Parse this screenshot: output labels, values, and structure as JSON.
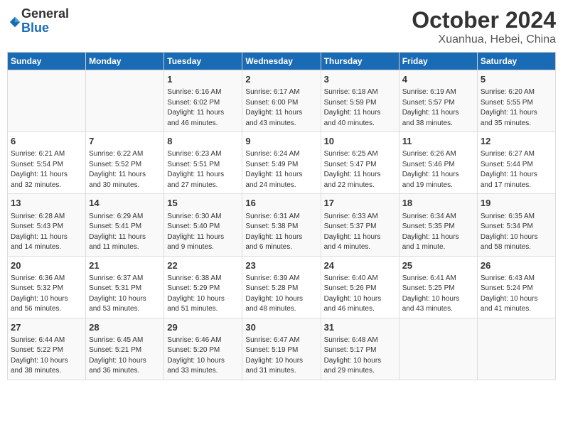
{
  "header": {
    "logo_general": "General",
    "logo_blue": "Blue",
    "title": "October 2024",
    "subtitle": "Xuanhua, Hebei, China"
  },
  "columns": [
    "Sunday",
    "Monday",
    "Tuesday",
    "Wednesday",
    "Thursday",
    "Friday",
    "Saturday"
  ],
  "rows": [
    [
      {
        "day": "",
        "lines": []
      },
      {
        "day": "",
        "lines": []
      },
      {
        "day": "1",
        "lines": [
          "Sunrise: 6:16 AM",
          "Sunset: 6:02 PM",
          "Daylight: 11 hours",
          "and 46 minutes."
        ]
      },
      {
        "day": "2",
        "lines": [
          "Sunrise: 6:17 AM",
          "Sunset: 6:00 PM",
          "Daylight: 11 hours",
          "and 43 minutes."
        ]
      },
      {
        "day": "3",
        "lines": [
          "Sunrise: 6:18 AM",
          "Sunset: 5:59 PM",
          "Daylight: 11 hours",
          "and 40 minutes."
        ]
      },
      {
        "day": "4",
        "lines": [
          "Sunrise: 6:19 AM",
          "Sunset: 5:57 PM",
          "Daylight: 11 hours",
          "and 38 minutes."
        ]
      },
      {
        "day": "5",
        "lines": [
          "Sunrise: 6:20 AM",
          "Sunset: 5:55 PM",
          "Daylight: 11 hours",
          "and 35 minutes."
        ]
      }
    ],
    [
      {
        "day": "6",
        "lines": [
          "Sunrise: 6:21 AM",
          "Sunset: 5:54 PM",
          "Daylight: 11 hours",
          "and 32 minutes."
        ]
      },
      {
        "day": "7",
        "lines": [
          "Sunrise: 6:22 AM",
          "Sunset: 5:52 PM",
          "Daylight: 11 hours",
          "and 30 minutes."
        ]
      },
      {
        "day": "8",
        "lines": [
          "Sunrise: 6:23 AM",
          "Sunset: 5:51 PM",
          "Daylight: 11 hours",
          "and 27 minutes."
        ]
      },
      {
        "day": "9",
        "lines": [
          "Sunrise: 6:24 AM",
          "Sunset: 5:49 PM",
          "Daylight: 11 hours",
          "and 24 minutes."
        ]
      },
      {
        "day": "10",
        "lines": [
          "Sunrise: 6:25 AM",
          "Sunset: 5:47 PM",
          "Daylight: 11 hours",
          "and 22 minutes."
        ]
      },
      {
        "day": "11",
        "lines": [
          "Sunrise: 6:26 AM",
          "Sunset: 5:46 PM",
          "Daylight: 11 hours",
          "and 19 minutes."
        ]
      },
      {
        "day": "12",
        "lines": [
          "Sunrise: 6:27 AM",
          "Sunset: 5:44 PM",
          "Daylight: 11 hours",
          "and 17 minutes."
        ]
      }
    ],
    [
      {
        "day": "13",
        "lines": [
          "Sunrise: 6:28 AM",
          "Sunset: 5:43 PM",
          "Daylight: 11 hours",
          "and 14 minutes."
        ]
      },
      {
        "day": "14",
        "lines": [
          "Sunrise: 6:29 AM",
          "Sunset: 5:41 PM",
          "Daylight: 11 hours",
          "and 11 minutes."
        ]
      },
      {
        "day": "15",
        "lines": [
          "Sunrise: 6:30 AM",
          "Sunset: 5:40 PM",
          "Daylight: 11 hours",
          "and 9 minutes."
        ]
      },
      {
        "day": "16",
        "lines": [
          "Sunrise: 6:31 AM",
          "Sunset: 5:38 PM",
          "Daylight: 11 hours",
          "and 6 minutes."
        ]
      },
      {
        "day": "17",
        "lines": [
          "Sunrise: 6:33 AM",
          "Sunset: 5:37 PM",
          "Daylight: 11 hours",
          "and 4 minutes."
        ]
      },
      {
        "day": "18",
        "lines": [
          "Sunrise: 6:34 AM",
          "Sunset: 5:35 PM",
          "Daylight: 11 hours",
          "and 1 minute."
        ]
      },
      {
        "day": "19",
        "lines": [
          "Sunrise: 6:35 AM",
          "Sunset: 5:34 PM",
          "Daylight: 10 hours",
          "and 58 minutes."
        ]
      }
    ],
    [
      {
        "day": "20",
        "lines": [
          "Sunrise: 6:36 AM",
          "Sunset: 5:32 PM",
          "Daylight: 10 hours",
          "and 56 minutes."
        ]
      },
      {
        "day": "21",
        "lines": [
          "Sunrise: 6:37 AM",
          "Sunset: 5:31 PM",
          "Daylight: 10 hours",
          "and 53 minutes."
        ]
      },
      {
        "day": "22",
        "lines": [
          "Sunrise: 6:38 AM",
          "Sunset: 5:29 PM",
          "Daylight: 10 hours",
          "and 51 minutes."
        ]
      },
      {
        "day": "23",
        "lines": [
          "Sunrise: 6:39 AM",
          "Sunset: 5:28 PM",
          "Daylight: 10 hours",
          "and 48 minutes."
        ]
      },
      {
        "day": "24",
        "lines": [
          "Sunrise: 6:40 AM",
          "Sunset: 5:26 PM",
          "Daylight: 10 hours",
          "and 46 minutes."
        ]
      },
      {
        "day": "25",
        "lines": [
          "Sunrise: 6:41 AM",
          "Sunset: 5:25 PM",
          "Daylight: 10 hours",
          "and 43 minutes."
        ]
      },
      {
        "day": "26",
        "lines": [
          "Sunrise: 6:43 AM",
          "Sunset: 5:24 PM",
          "Daylight: 10 hours",
          "and 41 minutes."
        ]
      }
    ],
    [
      {
        "day": "27",
        "lines": [
          "Sunrise: 6:44 AM",
          "Sunset: 5:22 PM",
          "Daylight: 10 hours",
          "and 38 minutes."
        ]
      },
      {
        "day": "28",
        "lines": [
          "Sunrise: 6:45 AM",
          "Sunset: 5:21 PM",
          "Daylight: 10 hours",
          "and 36 minutes."
        ]
      },
      {
        "day": "29",
        "lines": [
          "Sunrise: 6:46 AM",
          "Sunset: 5:20 PM",
          "Daylight: 10 hours",
          "and 33 minutes."
        ]
      },
      {
        "day": "30",
        "lines": [
          "Sunrise: 6:47 AM",
          "Sunset: 5:19 PM",
          "Daylight: 10 hours",
          "and 31 minutes."
        ]
      },
      {
        "day": "31",
        "lines": [
          "Sunrise: 6:48 AM",
          "Sunset: 5:17 PM",
          "Daylight: 10 hours",
          "and 29 minutes."
        ]
      },
      {
        "day": "",
        "lines": []
      },
      {
        "day": "",
        "lines": []
      }
    ]
  ]
}
